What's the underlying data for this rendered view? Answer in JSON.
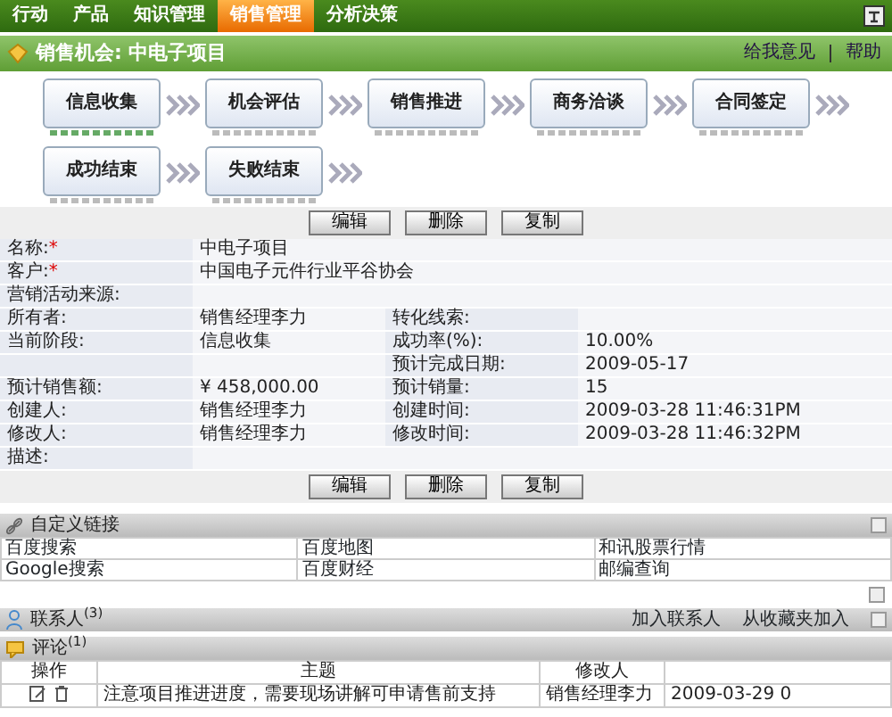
{
  "nav": {
    "tabs": [
      {
        "label": "行动",
        "selected": false
      },
      {
        "label": "产品",
        "selected": false
      },
      {
        "label": "知识管理",
        "selected": false
      },
      {
        "label": "销售管理",
        "selected": true
      },
      {
        "label": "分析决策",
        "selected": false
      }
    ]
  },
  "header": {
    "title": "销售机会: 中电子项目",
    "links": [
      "给我意见",
      "帮助"
    ]
  },
  "stages": [
    {
      "label": "信息收集",
      "current": true
    },
    {
      "label": "机会评估",
      "current": false
    },
    {
      "label": "销售推进",
      "current": false
    },
    {
      "label": "商务洽谈",
      "current": false
    },
    {
      "label": "合同签定",
      "current": false
    },
    {
      "label": "成功结束",
      "current": false
    },
    {
      "label": "失败结束",
      "current": false
    }
  ],
  "actions_top": [
    "编辑",
    "删除",
    "复制"
  ],
  "fields": [
    {
      "kind": "wide",
      "label": "名称:",
      "marker": "*",
      "value": "中电子项目"
    },
    {
      "kind": "wide",
      "label": "客户:",
      "marker": "*",
      "value": "中国电子元件行业平谷协会"
    },
    {
      "kind": "wide",
      "label": "营销活动来源:"
    },
    {
      "kind": "pair",
      "cells": [
        "所有者:",
        "销售经理李力",
        "转化线索:",
        ""
      ]
    },
    {
      "kind": "pair",
      "cells": [
        "当前阶段:",
        "信息收集",
        "成功率(%):",
        "10.00%"
      ]
    },
    {
      "kind": "pair",
      "cells": [
        "",
        "",
        "预计完成日期:",
        "2009-05-17"
      ]
    },
    {
      "kind": "pair",
      "cells": [
        "预计销售额:",
        "¥ 458,000.00",
        "预计销量:",
        "15"
      ]
    },
    {
      "kind": "pair",
      "cells": [
        "创建人:",
        "销售经理李力",
        "创建时间:",
        "2009-03-28 11:46:31PM"
      ]
    },
    {
      "kind": "pair",
      "cells": [
        "修改人:",
        "销售经理李力",
        "修改时间:",
        "2009-03-28 11:46:32PM"
      ]
    },
    {
      "kind": "wide",
      "label": "描述:"
    }
  ],
  "actions_bottom": [
    "编辑",
    "删除",
    "复制"
  ],
  "custom_links": {
    "title": "自定义链接",
    "rows": [
      [
        "百度搜索",
        "百度地图",
        "和讯股票行情"
      ],
      [
        "Google搜索",
        "百度财经",
        "邮编查询"
      ]
    ]
  },
  "contacts": {
    "title": "联系人$^{(3)}$",
    "actions": [
      "加入联系人",
      "从收藏夹加入"
    ]
  },
  "comments": {
    "title": "评论$^{(1)}$",
    "columns": [
      "操作",
      "主题",
      "修改人"
    ],
    "rows": [
      {
        "subject": "注意项目推进进度，需要现场讲解可申请售前支持",
        "modifier": "销售经理李力",
        "date": "2009-03-29 0"
      }
    ]
  }
}
